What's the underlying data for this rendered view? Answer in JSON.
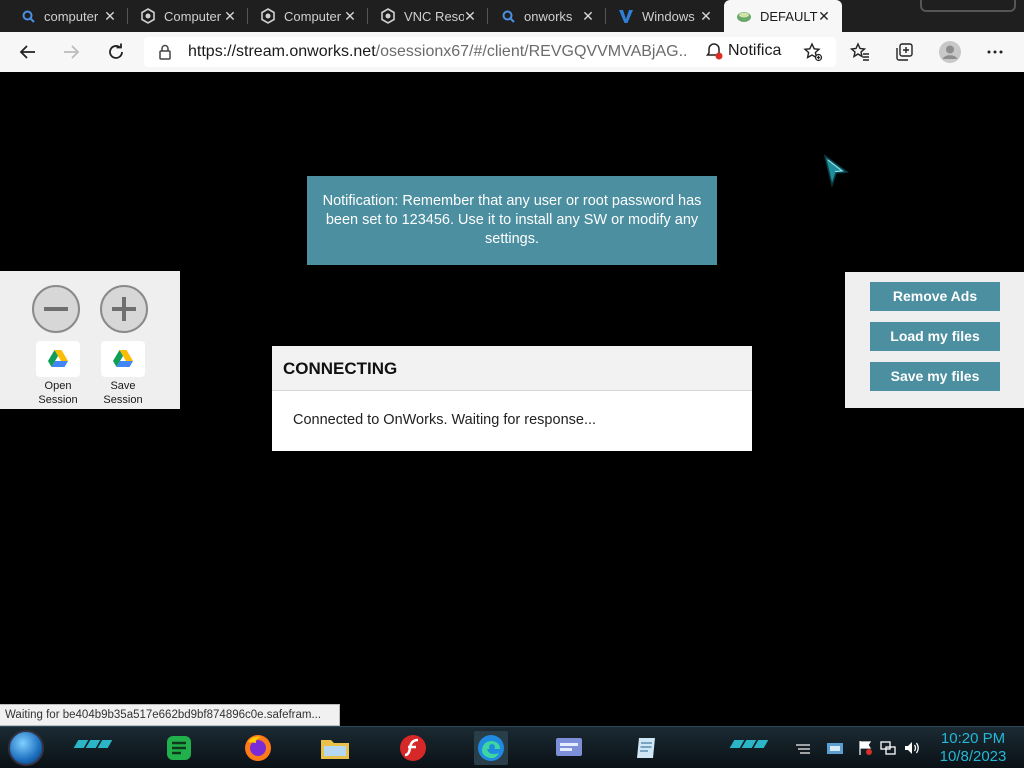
{
  "browser": {
    "tabs": [
      {
        "label": "computer",
        "icon": "search-icon",
        "active": false
      },
      {
        "label": "Computer",
        "icon": "tab-site-icon",
        "active": false
      },
      {
        "label": "Computer",
        "icon": "tab-site-icon",
        "active": false
      },
      {
        "label": "VNC Reso",
        "icon": "tab-site-icon",
        "active": false
      },
      {
        "label": "onworks",
        "icon": "search-icon",
        "active": false
      },
      {
        "label": "Windows",
        "icon": "v-logo-icon",
        "active": false
      },
      {
        "label": "DEFAULT",
        "icon": "onworks-icon",
        "active": true
      }
    ],
    "url_host": "https://stream.onworks.net",
    "url_path": "/osessionx67/#/client/REVGQVVMVABjAG...",
    "notification_chip": "Notifica"
  },
  "session": {
    "notification": "Notification: Remember that any user or root password has been set to 123456. Use it to install any SW or modify any settings.",
    "dialog_title": "CONNECTING",
    "dialog_message": "Connected to OnWorks. Waiting for response...",
    "left_panel": {
      "open_label_1": "Open",
      "open_label_2": "Session",
      "save_label_1": "Save",
      "save_label_2": "Session"
    },
    "right_panel": {
      "remove_ads": "Remove Ads",
      "load_files": "Load my files",
      "save_files": "Save my files"
    }
  },
  "status_text": "Waiting for be404b9b35a517e662bd9bf874896c0e.safefram...",
  "taskbar": {
    "time": "10:20 PM",
    "date": "10/8/2023"
  },
  "colors": {
    "accent": "#4b8fa0",
    "clock": "#24b7d6"
  }
}
